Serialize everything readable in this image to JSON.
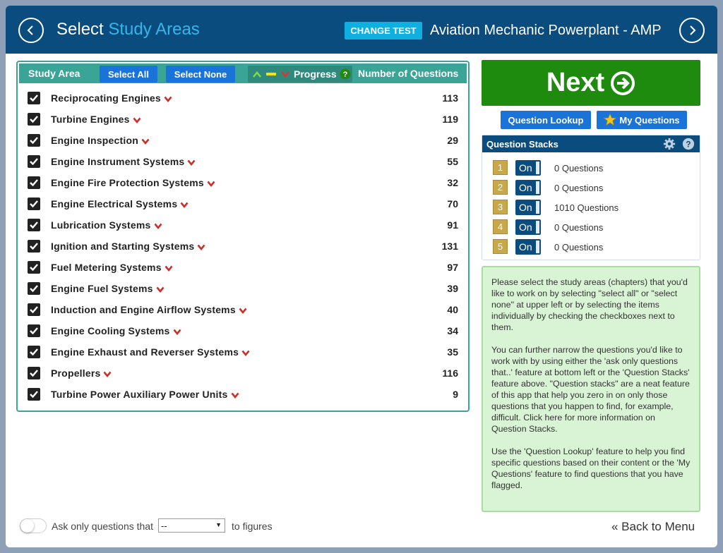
{
  "header": {
    "title_prefix": "Select",
    "title_accent": "Study Areas",
    "change_test_label": "CHANGE TEST",
    "test_name": "Aviation Mechanic Powerplant - AMP",
    "prev_icon": "chevron-left-icon",
    "next_icon": "chevron-right-icon"
  },
  "study_panel": {
    "header_label": "Study Area",
    "select_all_label": "Select All",
    "select_none_label": "Select None",
    "progress_label": "Progress",
    "count_header": "Number of Questions",
    "items": [
      {
        "label": "Reciprocating Engines",
        "count": "113",
        "checked": true
      },
      {
        "label": "Turbine Engines",
        "count": "119",
        "checked": true
      },
      {
        "label": "Engine Inspection",
        "count": "29",
        "checked": true
      },
      {
        "label": "Engine Instrument Systems",
        "count": "55",
        "checked": true
      },
      {
        "label": "Engine Fire Protection Systems",
        "count": "32",
        "checked": true
      },
      {
        "label": "Engine Electrical Systems",
        "count": "70",
        "checked": true
      },
      {
        "label": "Lubrication Systems",
        "count": "91",
        "checked": true
      },
      {
        "label": "Ignition and Starting Systems",
        "count": "131",
        "checked": true
      },
      {
        "label": "Fuel Metering Systems",
        "count": "97",
        "checked": true
      },
      {
        "label": "Engine Fuel Systems",
        "count": "39",
        "checked": true
      },
      {
        "label": "Induction and Engine Airflow Systems",
        "count": "40",
        "checked": true
      },
      {
        "label": "Engine Cooling Systems",
        "count": "34",
        "checked": true
      },
      {
        "label": "Engine Exhaust and Reverser Systems",
        "count": "35",
        "checked": true
      },
      {
        "label": "Propellers",
        "count": "116",
        "checked": true
      },
      {
        "label": "Turbine Power Auxiliary Power Units",
        "count": "9",
        "checked": true
      }
    ]
  },
  "actions": {
    "next_label": "Next",
    "question_lookup_label": "Question Lookup",
    "my_questions_label": "My Questions"
  },
  "stacks": {
    "title": "Question Stacks",
    "items": [
      {
        "num": "1",
        "state": "On",
        "questions": "0 Questions"
      },
      {
        "num": "2",
        "state": "On",
        "questions": "0 Questions"
      },
      {
        "num": "3",
        "state": "On",
        "questions": "1010 Questions"
      },
      {
        "num": "4",
        "state": "On",
        "questions": "0 Questions"
      },
      {
        "num": "5",
        "state": "On",
        "questions": "0 Questions"
      }
    ]
  },
  "info": {
    "p1": "Please select the study areas (chapters) that you'd like to work on by selecting \"select all\" or \"select none\" at upper left or by selecting the items individually by checking the checkboxes next to them.",
    "p2": "You can further narrow the questions you'd like to work with by using either the 'ask only questions that..' feature at bottom left or the 'Question Stacks' feature above. \"Question stacks\" are a neat feature of this app that help you zero in on only those questions that you happen to find, for example, difficult. Click here for more information on Question Stacks.",
    "p3": "Use the 'Question Lookup' feature to help you find specific questions based on their content or the 'My Questions' feature to find questions that you have flagged."
  },
  "bottom": {
    "ask_prefix": "Ask only questions that",
    "select_value": "--",
    "ask_suffix": "to figures",
    "back_label": "« Back to Menu"
  },
  "colors": {
    "header_bg": "#0b4c7e",
    "accent": "#35b6ea",
    "panel_teal": "#3aa596",
    "button_blue": "#1a73d9",
    "next_green": "#1e8a0e",
    "chevron_red": "#c9302c",
    "stack_gold": "#c8a84b",
    "info_bg": "#d9f3d5"
  }
}
